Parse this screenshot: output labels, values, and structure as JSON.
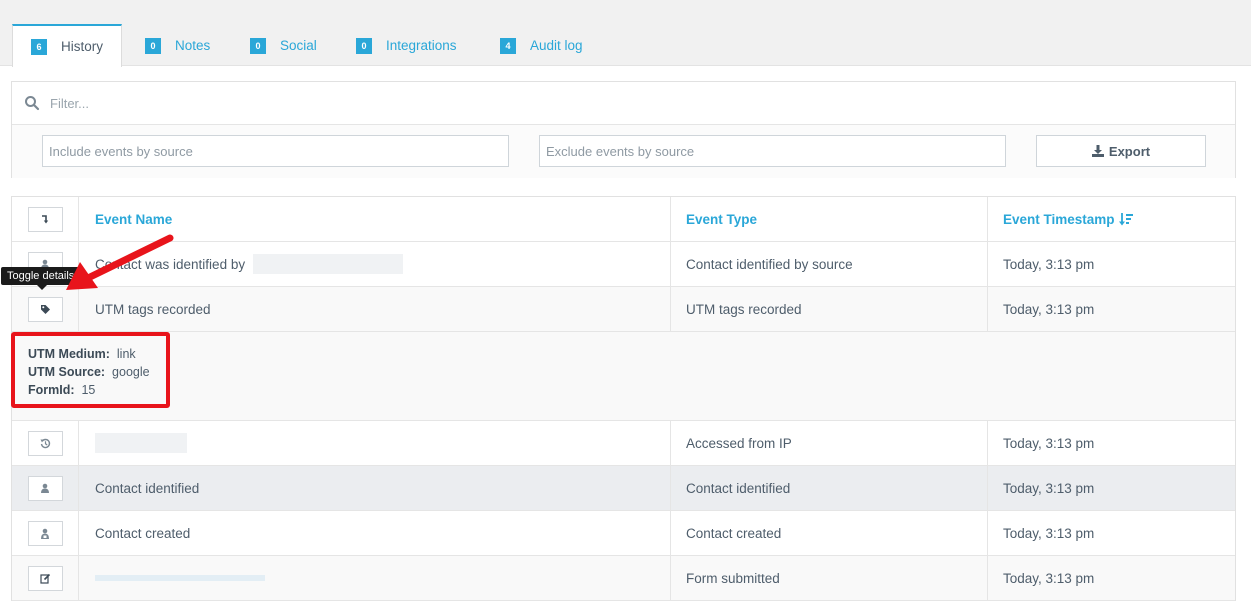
{
  "tabs": [
    {
      "count": "6",
      "label": "History",
      "active": true
    },
    {
      "count": "0",
      "label": "Notes"
    },
    {
      "count": "0",
      "label": "Social"
    },
    {
      "count": "0",
      "label": "Integrations"
    },
    {
      "count": "4",
      "label": "Audit log"
    }
  ],
  "filter": {
    "placeholder": "Filter..."
  },
  "sources": {
    "include_placeholder": "Include events by source",
    "exclude_placeholder": "Exclude events by source",
    "export_label": "Export"
  },
  "table": {
    "headers": {
      "name": "Event Name",
      "type": "Event Type",
      "timestamp": "Event Timestamp"
    },
    "rows": [
      {
        "icon": "user-icon",
        "name": "Contact was identified by",
        "type": "Contact identified by source",
        "timestamp": "Today, 3:13 pm"
      },
      {
        "icon": "tag-icon",
        "name": "UTM tags recorded",
        "type": "UTM tags recorded",
        "timestamp": "Today, 3:13 pm"
      },
      {
        "icon": "history-icon",
        "name": "",
        "type": "Accessed from IP",
        "timestamp": "Today, 3:13 pm"
      },
      {
        "icon": "user-icon",
        "name": "Contact identified",
        "type": "Contact identified",
        "timestamp": "Today, 3:13 pm"
      },
      {
        "icon": "user-lock-icon",
        "name": "Contact created",
        "type": "Contact created",
        "timestamp": "Today, 3:13 pm"
      },
      {
        "icon": "edit-icon",
        "name": "",
        "type": "Form submitted",
        "timestamp": "Today, 3:13 pm"
      }
    ],
    "details": [
      {
        "key": "UTM Medium:",
        "value": "link"
      },
      {
        "key": "UTM Source:",
        "value": "google"
      },
      {
        "key": "FormId:",
        "value": "15"
      }
    ]
  },
  "tooltip": {
    "text": "Toggle details"
  },
  "colors": {
    "accent": "#2aa7d8",
    "highlight": "#e8141b"
  }
}
